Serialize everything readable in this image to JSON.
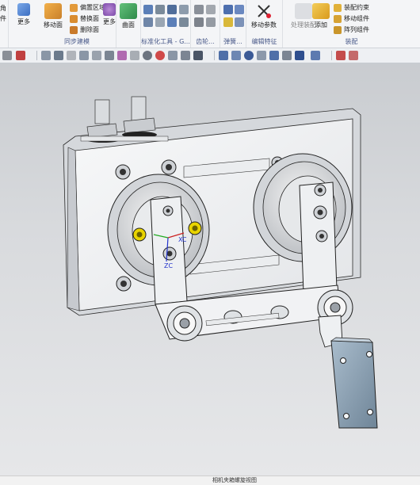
{
  "ribbon": {
    "partial_left": {
      "line1": "角",
      "line2": "件"
    },
    "more1": "更多",
    "sync": {
      "move_face": "移动面",
      "offset_region": "偏置区域",
      "replace_face": "替换面",
      "delete_face": "删除面",
      "more": "更多",
      "group": "同步建模"
    },
    "surface": {
      "label": "曲面"
    },
    "standard_group": "标准化工具 - G...",
    "gear_group": "齿轮...",
    "spring_group": "弹簧...",
    "edit_feature": {
      "move_param": "移动参数",
      "group": "编辑特征"
    },
    "assembly": {
      "process_assembly": "处理装配",
      "add": "添加",
      "assembly_constraint": "装配约束",
      "move_component": "移动组件",
      "array_component": "阵列组件",
      "group": "装配"
    }
  },
  "viewport": {
    "csys_x": "XC",
    "csys_z": "ZC"
  },
  "status": {
    "text": "相机夹箱螺旋视图"
  },
  "colors": {
    "accent": "#2f66c7",
    "ribbon_bg": "#f4f5f7",
    "viewport_top": "#c9ccd0",
    "part_face": "#f3f4f5",
    "part_edge": "#2b2b2b",
    "bolt_yellow": "#e6d200",
    "bracket": "#8aa1b5"
  }
}
